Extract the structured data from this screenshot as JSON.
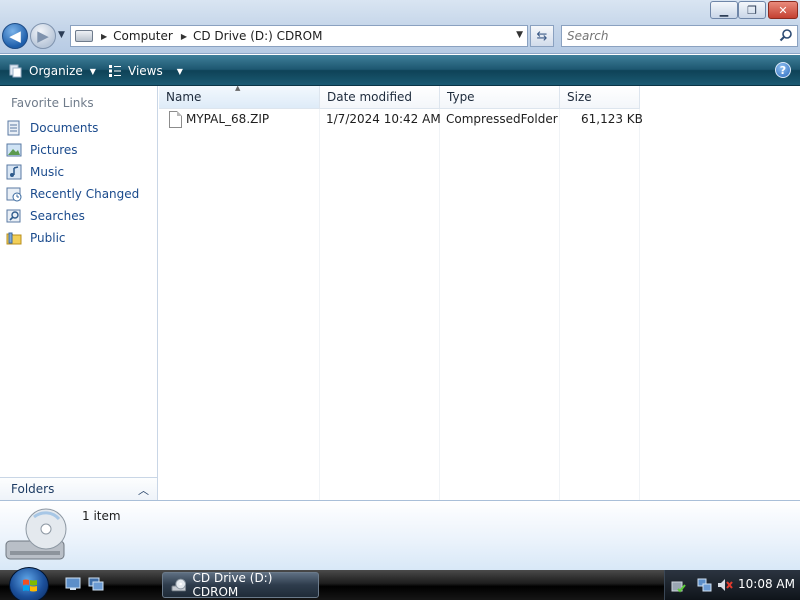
{
  "window": {
    "controls": {
      "minimize": "▁",
      "maximize": "❐",
      "close": "✕"
    }
  },
  "nav": {
    "back_icon": "arrow-left-icon",
    "forward_icon": "arrow-right-icon"
  },
  "address": {
    "crumbs": [
      "Computer",
      "CD Drive (D:) CDROM"
    ]
  },
  "search": {
    "placeholder": "Search"
  },
  "toolbar": {
    "organize_label": "Organize",
    "views_label": "Views"
  },
  "sidebar": {
    "title": "Favorite Links",
    "items": [
      {
        "label": "Documents",
        "icon": "documents-icon"
      },
      {
        "label": "Pictures",
        "icon": "pictures-icon"
      },
      {
        "label": "Music",
        "icon": "music-icon"
      },
      {
        "label": "Recently Changed",
        "icon": "recently-changed-icon"
      },
      {
        "label": "Searches",
        "icon": "searches-icon"
      },
      {
        "label": "Public",
        "icon": "public-folder-icon"
      }
    ],
    "folders_label": "Folders"
  },
  "filelist": {
    "columns": [
      "Name",
      "Date modified",
      "Type",
      "Size"
    ],
    "rows": [
      {
        "name": "MYPAL_68.ZIP",
        "date": "1/7/2024 10:42 AM",
        "type": "CompressedFolder",
        "size": "61,123 KB"
      }
    ]
  },
  "details": {
    "count": "1 item"
  },
  "taskbar": {
    "task_label": "CD Drive (D:) CDROM",
    "clock": "10:08 AM"
  },
  "colors": {
    "accent": "#1d5770",
    "link": "#1a4a8c"
  }
}
